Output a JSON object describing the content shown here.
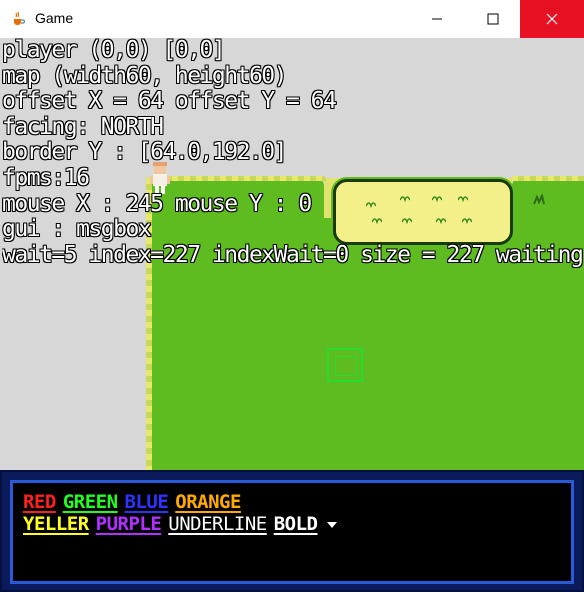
{
  "window": {
    "title": "Game",
    "app_icon": "java-cup-icon",
    "controls": {
      "minimize": "minimize-icon",
      "maximize": "maximize-icon",
      "close": "close-icon"
    },
    "close_color": "#e81123"
  },
  "debug": {
    "lines": [
      "player (0,0) [0,0]",
      "map (width60, height60)",
      "offset X = 64 offset Y = 64",
      "facing: NORTH",
      "border Y : [64.0,192.0]",
      "fpms:16",
      "mouse X : 245 mouse Y : 0",
      "gui : msgbox",
      "wait=5 index=227 indexWait=0 size = 227 waiting"
    ]
  },
  "message_box": {
    "line1": [
      {
        "text": "RED",
        "color": "#ff2020"
      },
      {
        "text": "GREEN",
        "color": "#20ff20"
      },
      {
        "text": "BLUE",
        "color": "#3030ff"
      },
      {
        "text": "ORANGE",
        "color": "#ffaa00"
      }
    ],
    "line2": [
      {
        "text": "YELLER",
        "color": "#ffff20"
      },
      {
        "text": "PURPLE",
        "color": "#b030ff"
      },
      {
        "text": "UNDERLINE",
        "color": "#ffffff"
      },
      {
        "text": "BOLD",
        "color": "#ffffff"
      }
    ],
    "continue_icon": "down-arrow-icon"
  },
  "colors": {
    "grass": "#5ebc20",
    "void": "#d7d7d7",
    "msgbox_border": "#2a5ad8",
    "marker": "#22e02a"
  }
}
